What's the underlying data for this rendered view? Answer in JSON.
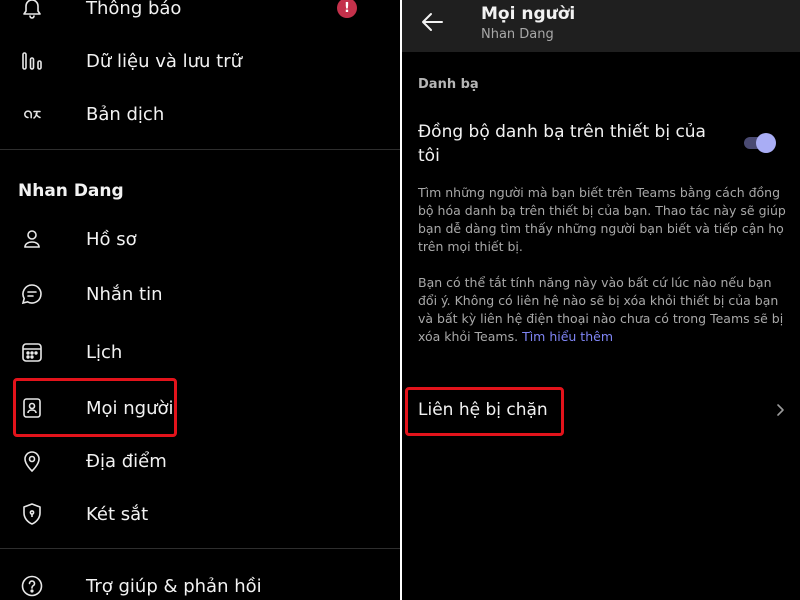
{
  "left_menu": {
    "top_items": [
      {
        "label": "Thông báo",
        "icon": "bell-icon",
        "badge": "!"
      },
      {
        "label": "Dữ liệu và lưu trữ",
        "icon": "data-storage-icon"
      },
      {
        "label": "Bản dịch",
        "icon": "translate-icon"
      }
    ],
    "section_title": "Nhan Dang",
    "section_items": [
      {
        "label": "Hồ sơ",
        "icon": "profile-icon"
      },
      {
        "label": "Nhắn tin",
        "icon": "chat-icon"
      },
      {
        "label": "Lịch",
        "icon": "calendar-icon"
      },
      {
        "label": "Mọi người",
        "icon": "contacts-icon",
        "highlighted": true
      },
      {
        "label": "Địa điểm",
        "icon": "location-icon"
      },
      {
        "label": "Két sắt",
        "icon": "shield-lock-icon"
      }
    ],
    "bottom_items": [
      {
        "label": "Trợ giúp & phản hồi",
        "icon": "help-icon"
      }
    ]
  },
  "right_panel": {
    "header": {
      "title": "Mọi người",
      "subtitle": "Nhan Dang",
      "back_icon": "back-arrow-icon"
    },
    "section_label": "Danh bạ",
    "sync_setting": {
      "label": "Đồng bộ danh bạ trên thiết bị của tôi",
      "enabled": true
    },
    "description_1": "Tìm những người mà bạn biết trên Teams bằng cách đồng bộ hóa danh bạ trên thiết bị của bạn. Thao tác này sẽ giúp bạn dễ dàng tìm thấy những người bạn biết và tiếp cận họ trên mọi thiết bị.",
    "description_2": "Bạn có thể tắt tính năng này vào bất cứ lúc nào nếu bạn đổi ý. Không có liên hệ nào sẽ bị xóa khỏi thiết bị của bạn và bất kỳ liên hệ điện thoại nào chưa có trong Teams sẽ bị xóa khỏi Teams.",
    "learn_more": "Tìm hiểu thêm",
    "blocked_contacts": {
      "label": "Liên hệ bị chặn",
      "highlighted": true
    }
  },
  "colors": {
    "background": "#000000",
    "header_bg": "#1f1f1f",
    "highlight": "#e3131b",
    "accent": "#7f85f5",
    "badge": "#c4314b",
    "toggle_knob": "#a9adf5"
  }
}
